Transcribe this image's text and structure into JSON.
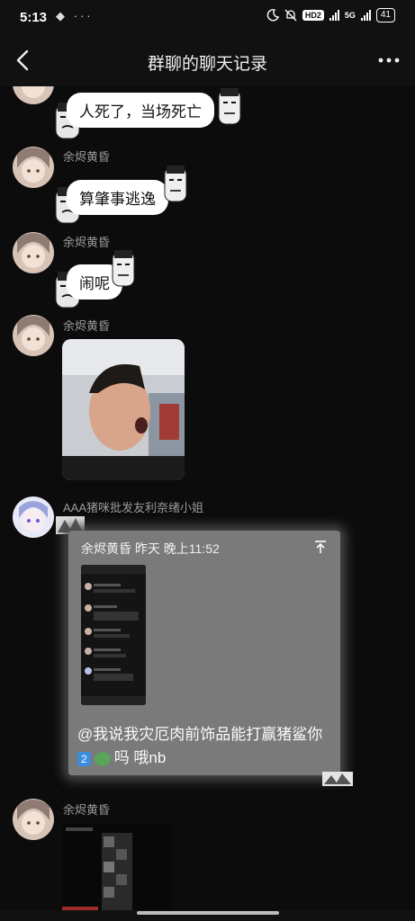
{
  "status_bar": {
    "time": "5:13",
    "left_icons": "◆ ···",
    "hd": "HD2",
    "network": "5G",
    "battery": "41"
  },
  "nav": {
    "title": "群聊的聊天记录"
  },
  "messages": [
    {
      "sender": "",
      "text": "人死了，当场死亡"
    },
    {
      "sender": "余烬黄昏",
      "text": "算肇事逃逸"
    },
    {
      "sender": "余烬黄昏",
      "text": "闹呢"
    },
    {
      "sender": "余烬黄昏",
      "type": "image"
    },
    {
      "sender": "AAA猪咪批发友利奈绪小姐",
      "quote": {
        "header": "余烬黄昏  昨天 晚上11:52",
        "text_before": "@我说我灾厄肉前饰品能打赢猪鲨你",
        "num": "2",
        "text_after": "吗 哦nb"
      }
    },
    {
      "sender": "余烬黄昏",
      "type": "image"
    }
  ],
  "colors": {
    "background": "#0c0c0c",
    "bubble": "#ffffff",
    "quote_card": "#7a7a7a",
    "name_text": "#9a9a9a"
  },
  "icons": [
    "back-arrow-icon",
    "more-icon",
    "moon-icon",
    "mute-icon",
    "signal-icon",
    "battery-icon",
    "pin-icon"
  ]
}
